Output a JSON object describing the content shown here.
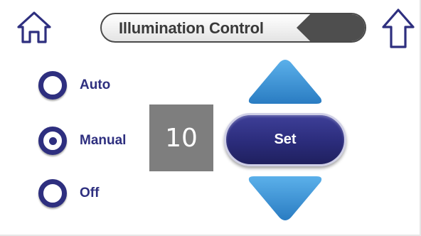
{
  "header": {
    "title": "Illumination Control",
    "home_icon": "home-icon",
    "up_icon": "arrow-up-icon"
  },
  "mode": {
    "options": [
      {
        "label": "Auto",
        "selected": false
      },
      {
        "label": "Manual",
        "selected": true
      },
      {
        "label": "Off",
        "selected": false
      }
    ]
  },
  "level": {
    "value": "10",
    "set_label": "Set",
    "increase_icon": "triangle-up-icon",
    "decrease_icon": "triangle-down-icon"
  },
  "colors": {
    "accent": "#2e2f7f",
    "arrow_blue": "#3a8fd0",
    "value_box": "#7e7e7e",
    "title_tab": "#4e4e4e"
  }
}
